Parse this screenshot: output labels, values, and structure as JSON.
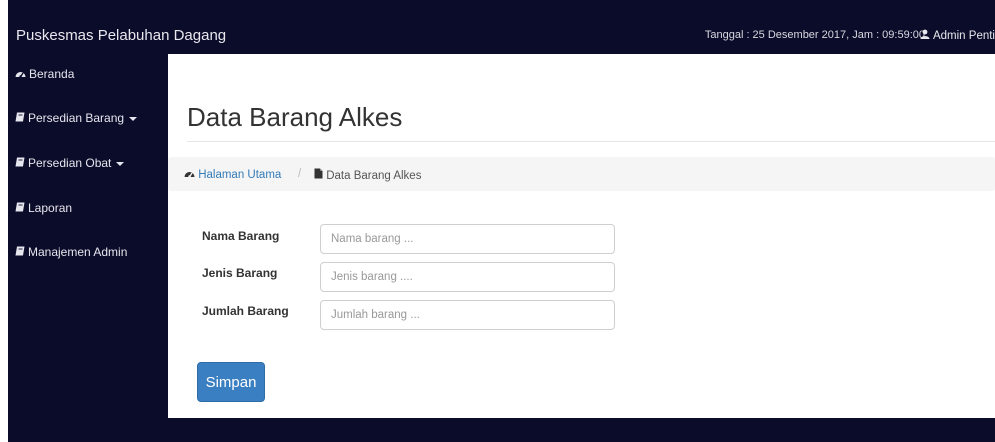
{
  "header": {
    "brand": "Puskesmas Pelabuhan Dagang",
    "datetime": "Tanggal : 25 Desember 2017, Jam : 09:59:00",
    "user": "Admin Penti"
  },
  "sidebar": {
    "items": [
      {
        "label": "Beranda",
        "icon": "dashboard-icon",
        "dropdown": false
      },
      {
        "label": "Persedian Barang",
        "icon": "book-icon",
        "dropdown": true
      },
      {
        "label": "Persedian Obat",
        "icon": "book-icon",
        "dropdown": true
      },
      {
        "label": "Laporan",
        "icon": "book-icon",
        "dropdown": false
      },
      {
        "label": "Manajemen Admin",
        "icon": "book-icon",
        "dropdown": false
      }
    ]
  },
  "main": {
    "title": "Data Barang Alkes",
    "breadcrumb": {
      "home": "Halaman Utama",
      "separator": "/",
      "current": "Data Barang Alkes"
    },
    "form": {
      "fields": [
        {
          "label": "Nama Barang",
          "placeholder": "Nama barang ...",
          "value": ""
        },
        {
          "label": "Jenis Barang",
          "placeholder": "Jenis barang ....",
          "value": ""
        },
        {
          "label": "Jumlah Barang",
          "placeholder": "Jumlah barang ...",
          "value": ""
        }
      ],
      "submit_label": "Simpan"
    }
  },
  "colors": {
    "navbar": "#0b0b2a",
    "link": "#337ab7",
    "primary_button": "#3a7fc1",
    "breadcrumb_bg": "#f5f5f5"
  }
}
